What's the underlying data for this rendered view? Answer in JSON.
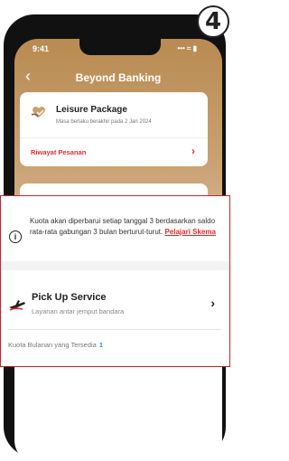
{
  "step_number": "4",
  "status_bar": {
    "time": "9:41",
    "icons": "••• ≈ ▮"
  },
  "nav": {
    "title": "Beyond Banking",
    "back_icon": "chevron-left-icon"
  },
  "package_card": {
    "title": "Leisure Package",
    "validity": "Masa berlaku berakhir pada 2 Jan 2024",
    "order_history_label": "Riwayat Pesanan",
    "icon": "heart-hand-icon"
  },
  "info": {
    "text": "Kuota akan diperbarui setiap tanggal 3 berdasarkan saldo rata-rata gabungan 3 bulan berturut-turut.",
    "link_label": "Pelajari Skema",
    "icon": "info-icon"
  },
  "pickup": {
    "title": "Pick Up Service",
    "subtitle": "Layanan antar jemput bandara",
    "quota_label": "Kuota Bulanan yang Tersedia",
    "quota_value": "1",
    "icon": "airplane-icon"
  },
  "colors": {
    "accent": "#e5282e",
    "gold": "#b98b52",
    "quota": "#16a0b8"
  }
}
